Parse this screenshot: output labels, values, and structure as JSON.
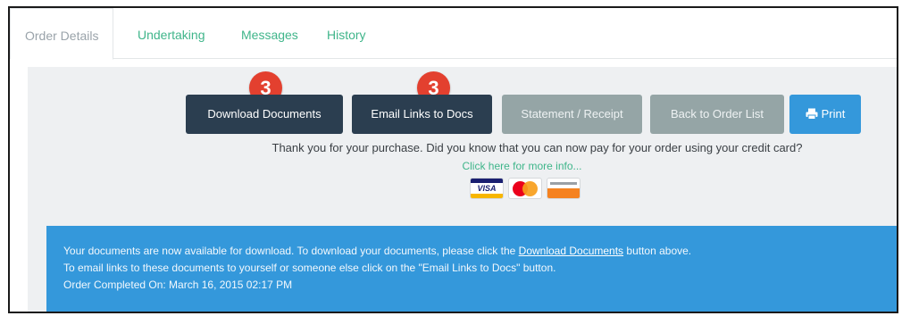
{
  "tabs": [
    {
      "label": "Order Details",
      "active": true
    },
    {
      "label": "Undertaking",
      "active": false
    },
    {
      "label": "Messages",
      "active": false
    },
    {
      "label": "History",
      "active": false
    }
  ],
  "buttons": {
    "download_docs": "Download Documents",
    "email_links": "Email Links to Docs",
    "statement": "Statement / Receipt",
    "back_to_list": "Back to Order List",
    "print": "Print"
  },
  "badges": {
    "download_docs": "3",
    "email_links": "3"
  },
  "info": {
    "message": "Thank you for your purchase. Did you know that you can now pay for your order using your credit card?",
    "link": "Click here for more info..."
  },
  "card_logos": [
    "visa-icon",
    "mastercard-icon",
    "discover-icon"
  ],
  "alert": {
    "line1_prefix": "Your documents are now available for download. To download your documents, please click the ",
    "line1_link": "Download Documents",
    "line1_suffix": " button above.",
    "line2": "To email links to these documents to yourself or someone else click on the \"Email Links to Docs\" button.",
    "line3": "Order Completed On: March 16, 2015 02:17 PM"
  },
  "colors": {
    "accent_green": "#3fb58a",
    "dark_button": "#2b3e50",
    "gray_button": "#95a5a6",
    "primary_blue": "#3498db",
    "badge_red": "#e3402f"
  }
}
